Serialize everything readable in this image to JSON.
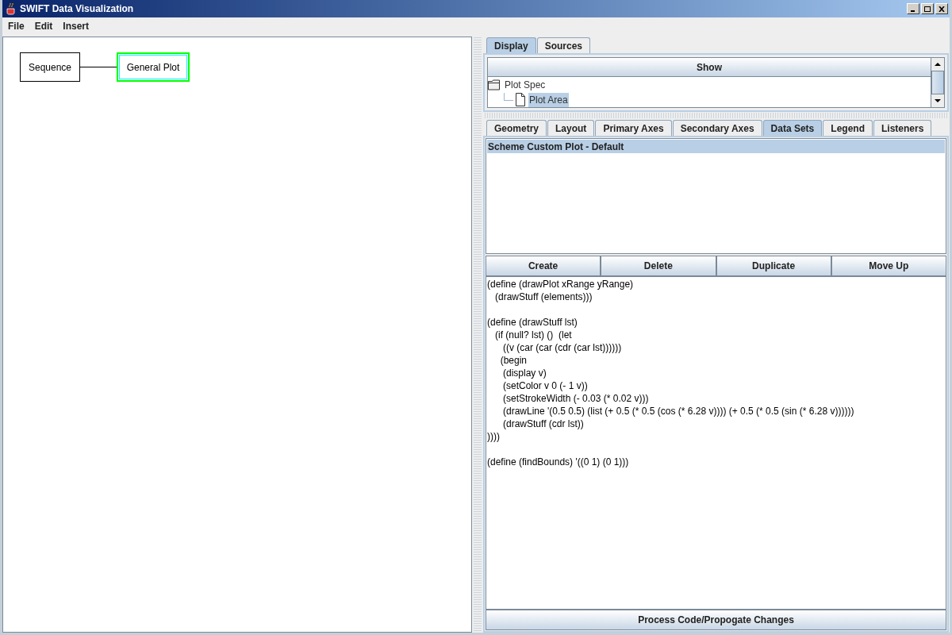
{
  "window": {
    "title": "SWIFT Data Visualization"
  },
  "menu": [
    {
      "label": "File"
    },
    {
      "label": "Edit"
    },
    {
      "label": "Insert"
    }
  ],
  "diagram": {
    "nodes": [
      {
        "label": "Sequence",
        "selected": false
      },
      {
        "label": "General Plot",
        "selected": true
      }
    ]
  },
  "top_tabs": [
    {
      "label": "Display",
      "selected": true
    },
    {
      "label": "Sources",
      "selected": false
    }
  ],
  "tree": {
    "header": "Show",
    "items": [
      {
        "label": "Plot Spec",
        "kind": "folder",
        "selected": false,
        "children": [
          {
            "label": "Plot Area",
            "kind": "file",
            "selected": true
          }
        ]
      }
    ]
  },
  "tabs": [
    {
      "label": "Geometry",
      "selected": false
    },
    {
      "label": "Layout",
      "selected": false
    },
    {
      "label": "Primary Axes",
      "selected": false
    },
    {
      "label": "Secondary Axes",
      "selected": false
    },
    {
      "label": "Data Sets",
      "selected": true
    },
    {
      "label": "Legend",
      "selected": false
    },
    {
      "label": "Listeners",
      "selected": false
    }
  ],
  "data_sets": [
    {
      "label": "Scheme Custom Plot - Default",
      "selected": true
    }
  ],
  "buttons": [
    "Create",
    "Delete",
    "Duplicate",
    "Move Up"
  ],
  "code": "(define (drawPlot xRange yRange)\n   (drawStuff (elements)))\n\n(define (drawStuff lst)\n   (if (null? lst) ()  (let\n      ((v (car (car (cdr (car lst))))))\n     (begin\n      (display v)\n      (setColor v 0 (- 1 v))\n      (setStrokeWidth (- 0.03 (* 0.02 v)))\n      (drawLine '(0.5 0.5) (list (+ 0.5 (* 0.5 (cos (* 6.28 v)))) (+ 0.5 (* 0.5 (sin (* 6.28 v))))))\n      (drawStuff (cdr lst))\n))))\n\n(define (findBounds) '((0 1) (0 1)))",
  "process_button": "Process Code/Propogate Changes"
}
